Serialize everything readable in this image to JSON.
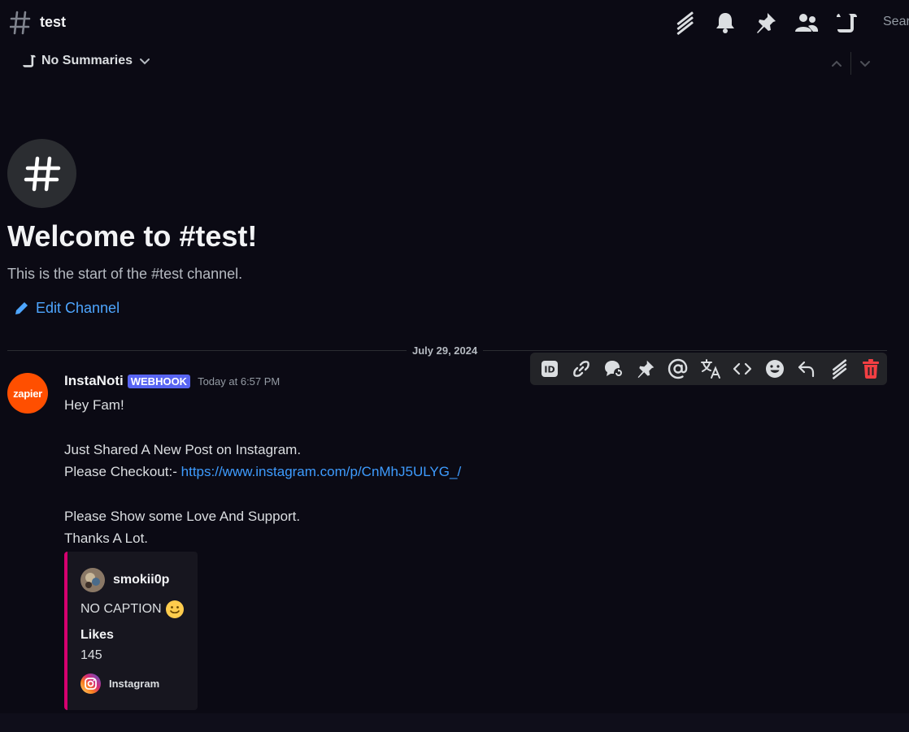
{
  "header": {
    "channel_name": "test",
    "search_label": "Search"
  },
  "summaries": {
    "label": "No Summaries"
  },
  "welcome": {
    "title": "Welcome to #test!",
    "subtitle": "This is the start of the #test channel.",
    "edit_label": "Edit Channel"
  },
  "divider": {
    "date": "July 29, 2024"
  },
  "message": {
    "author": "InstaNoti",
    "badge": "WEBHOOK",
    "timestamp": "Today at 6:57 PM",
    "avatar_text": "zapier",
    "lines": [
      "Hey Fam!",
      "",
      "Just Shared A New Post on Instagram.",
      "Please Checkout:- ",
      "",
      "Please Show some Love And Support.",
      "Thanks A Lot."
    ],
    "link": "https://www.instagram.com/p/CnMhJ5ULYG_/"
  },
  "embed": {
    "author": "smokii0p",
    "description": "NO CAPTION",
    "field_name": "Likes",
    "field_value": "145",
    "footer": "Instagram",
    "accent_color": "#d6006f"
  },
  "colors": {
    "background": "#0b0a14",
    "link": "#3e9cff",
    "webhook_badge": "#5865f2",
    "delete": "#f23f43"
  }
}
